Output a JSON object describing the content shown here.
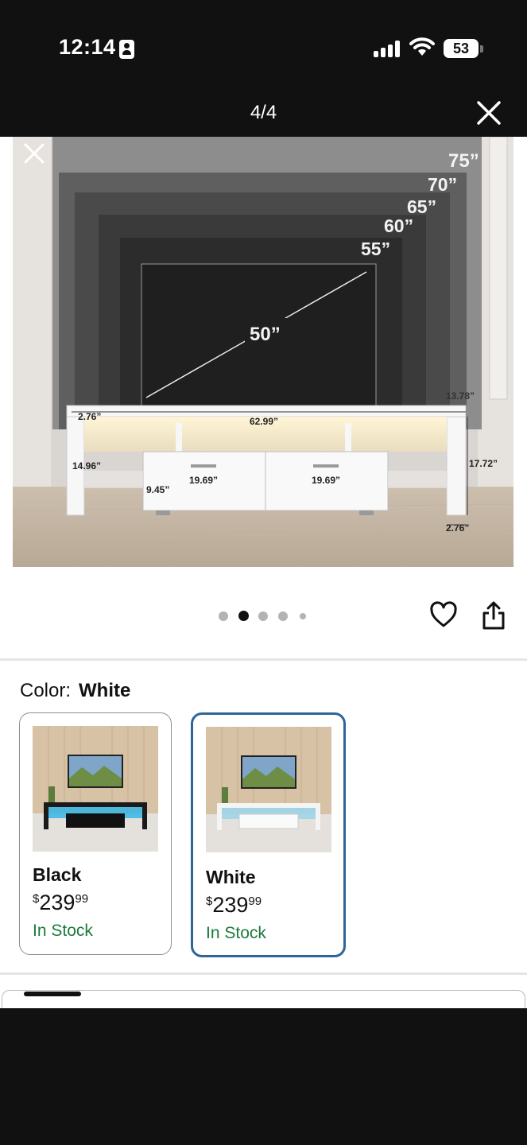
{
  "status_bar": {
    "time": "12:14",
    "battery": "53",
    "icons": [
      "id-card-icon",
      "cellular-signal-icon",
      "wifi-icon",
      "battery-icon"
    ]
  },
  "viewer": {
    "counter": "4/4",
    "close_icon": "close-icon"
  },
  "product_image": {
    "description_labels": {
      "screen_sizes": [
        "75”",
        "70”",
        "65”",
        "60”",
        "55”",
        "50”"
      ],
      "dimensions": [
        "2.76”",
        "62.99”",
        "13.78”",
        "14.96”",
        "19.69”",
        "19.69”",
        "9.45”",
        "17.72”",
        "2.76”"
      ]
    },
    "pager": {
      "count": 5,
      "active_index": 1
    },
    "colors": {
      "accent_selected": "#2e6599",
      "stock_green": "#1b7a3a"
    }
  },
  "actions": {
    "favorite_icon": "heart-icon",
    "share_icon": "share-icon"
  },
  "color_selector": {
    "label": "Color:",
    "selected": "White",
    "options": [
      {
        "name": "Black",
        "currency": "$",
        "price_whole": "239",
        "price_fraction": "99",
        "stock": "In Stock",
        "selected": false
      },
      {
        "name": "White",
        "currency": "$",
        "price_whole": "239",
        "price_fraction": "99",
        "stock": "In Stock",
        "selected": true
      }
    ]
  }
}
